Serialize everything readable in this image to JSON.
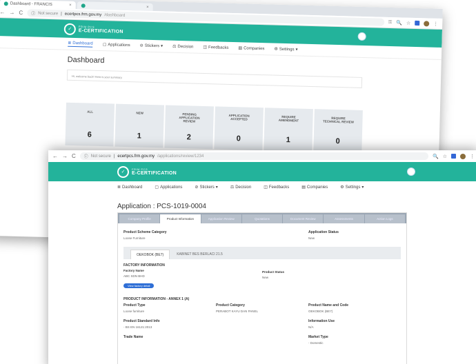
{
  "back": {
    "tabs": [
      {
        "label": "Dashboard - FRANCIS",
        "close": "×"
      },
      {
        "label": "",
        "close": "×"
      }
    ],
    "nav": {
      "back": "←",
      "forward": "→",
      "reload": "C"
    },
    "url": {
      "security": "Not secure",
      "host": "ecertpcs.frm.gov.my",
      "path": "/dashboard"
    },
    "brand": {
      "small": "FRIM PCS",
      "big": "E-CERTIFICATION"
    },
    "menu": [
      {
        "label": "Dashboard",
        "icon": "≣"
      },
      {
        "label": "Applications",
        "icon": "▢"
      },
      {
        "label": "Stickers",
        "icon": "⊘",
        "dropdown": "▾"
      },
      {
        "label": "Decision",
        "icon": "⚖"
      },
      {
        "label": "Feedbacks",
        "icon": "◫"
      },
      {
        "label": "Companies",
        "icon": "▤"
      },
      {
        "label": "Settings",
        "icon": "⚙",
        "dropdown": "▾"
      }
    ],
    "page_title": "Dashboard",
    "info_text": "Hi, welcome back! Here is your summary.",
    "stats": [
      {
        "label": "ALL",
        "value": "6"
      },
      {
        "label": "NEW",
        "value": "1"
      },
      {
        "label": "PENDING APPLICATION REVIEW",
        "value": "2"
      },
      {
        "label": "APPLICATION ACCEPTED",
        "value": "0"
      },
      {
        "label": "REQUIRE AMENDMENT",
        "value": "1"
      },
      {
        "label": "REQUIRE TECHNICAL REVIEW",
        "value": "0"
      }
    ]
  },
  "front": {
    "nav": {
      "back": "←",
      "forward": "→",
      "reload": "C"
    },
    "url": {
      "security": "Not secure",
      "host": "ecertpcs.frm.gov.my",
      "path": "/applications/review/1234"
    },
    "brand": {
      "small": "FRIM PCS",
      "big": "E-CERTIFICATION"
    },
    "menu": [
      {
        "label": "Dashboard",
        "icon": "≣"
      },
      {
        "label": "Applications",
        "icon": "▢"
      },
      {
        "label": "Stickers",
        "icon": "⊘",
        "dropdown": "▾"
      },
      {
        "label": "Decision",
        "icon": "⚖"
      },
      {
        "label": "Feedbacks",
        "icon": "◫"
      },
      {
        "label": "Companies",
        "icon": "▤"
      },
      {
        "label": "Settings",
        "icon": "⚙",
        "dropdown": "▾"
      }
    ],
    "app_title": "Application : PCS-1019-0004",
    "panel_tabs": [
      "Company Profile",
      "Product Information",
      "Application Review",
      "Quotations",
      "Document Review",
      "Assessments",
      "Action Logs"
    ],
    "product_scheme_category": {
      "label": "Product Scheme Category",
      "value": "Loose Furniture"
    },
    "application_status": {
      "label": "Application Status",
      "value": "New"
    },
    "sub_tabs": [
      "OEKOBOK (BE7)",
      "KABINET BES BERLACI 21.5"
    ],
    "factory": {
      "section": "FACTORY INFORMATION",
      "factory_name_label": "Factory Name",
      "factory_name_value": "ABC SDN BHD",
      "factory_button": "View factory detail",
      "product_status_label": "Product Status",
      "product_status_value": "New"
    },
    "product": {
      "section": "PRODUCT INFORMATION - ANNEX 1 (A)",
      "type_label": "Product Type",
      "type_value": "Loose furniture",
      "category_label": "Product Category",
      "category_value": "PERABOT KAYU DAN PANEL",
      "name_label": "Product Name and Code",
      "name_value": "OEKOBOK (BE7)",
      "standard_label": "Product Standard Info",
      "standard_value": "- BS EN 16121:2013",
      "info_use_label": "Information Use",
      "info_use_value": "N/A",
      "trade_label": "Trade Name",
      "market_label": "Market Type",
      "market_value": "- Domestic"
    }
  },
  "browser_icons": {
    "key": "⚿",
    "zoom": "🔍",
    "star": "☆",
    "menu": "⋮"
  },
  "colors": {
    "brand": "#23b39b",
    "link": "#2f6fd6",
    "tab_strip": "#9aa6b4"
  }
}
